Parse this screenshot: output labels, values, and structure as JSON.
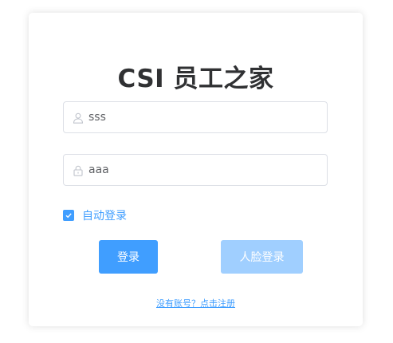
{
  "login": {
    "title": "CSI 员工之家",
    "username": {
      "value": "sss",
      "icon": "user-icon"
    },
    "password": {
      "value": "aaa",
      "icon": "lock-icon"
    },
    "remember": {
      "label": "自动登录",
      "checked": true
    },
    "buttons": {
      "login_label": "登录",
      "face_login_label": "人脸登录"
    },
    "register_link": "没有账号？点击注册"
  },
  "colors": {
    "primary": "#409eff",
    "primary_light": "#a0cfff",
    "title": "#303133",
    "border": "#dcdfe6",
    "icon": "#c0c4cc"
  }
}
